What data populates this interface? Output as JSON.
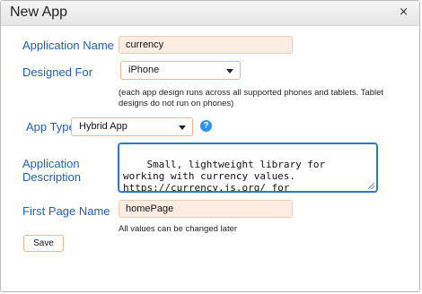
{
  "dialog": {
    "title": "New App",
    "close_glyph": "×"
  },
  "form": {
    "app_name": {
      "label": "Application Name",
      "value": "currency"
    },
    "designed_for": {
      "label": "Designed For",
      "selected": "iPhone",
      "note": "(each app design runs across all supported phones and tablets. Tablet designs do not run on phones)"
    },
    "app_type": {
      "label": "App Type",
      "selected": "Hybrid App",
      "help_glyph": "?"
    },
    "description": {
      "label": "Application Description",
      "value": "Small, lightweight library for working with currency values. https://currency.js.org/ for documentation."
    },
    "first_page": {
      "label": "First Page Name",
      "value": "homePage",
      "note": "All values can be changed later"
    },
    "save_label": "Save"
  },
  "icons": {
    "close": "close-icon",
    "dropdown": "chevron-down-icon",
    "help": "help-icon",
    "resize": "resize-grip-icon"
  },
  "colors": {
    "label": "#1e5fb4",
    "field_background": "#fdece1",
    "field_border": "#f0cbb2",
    "select_border": "#f2b58e",
    "focus_border": "#2b78d2",
    "help_icon": "#2c93e8"
  }
}
